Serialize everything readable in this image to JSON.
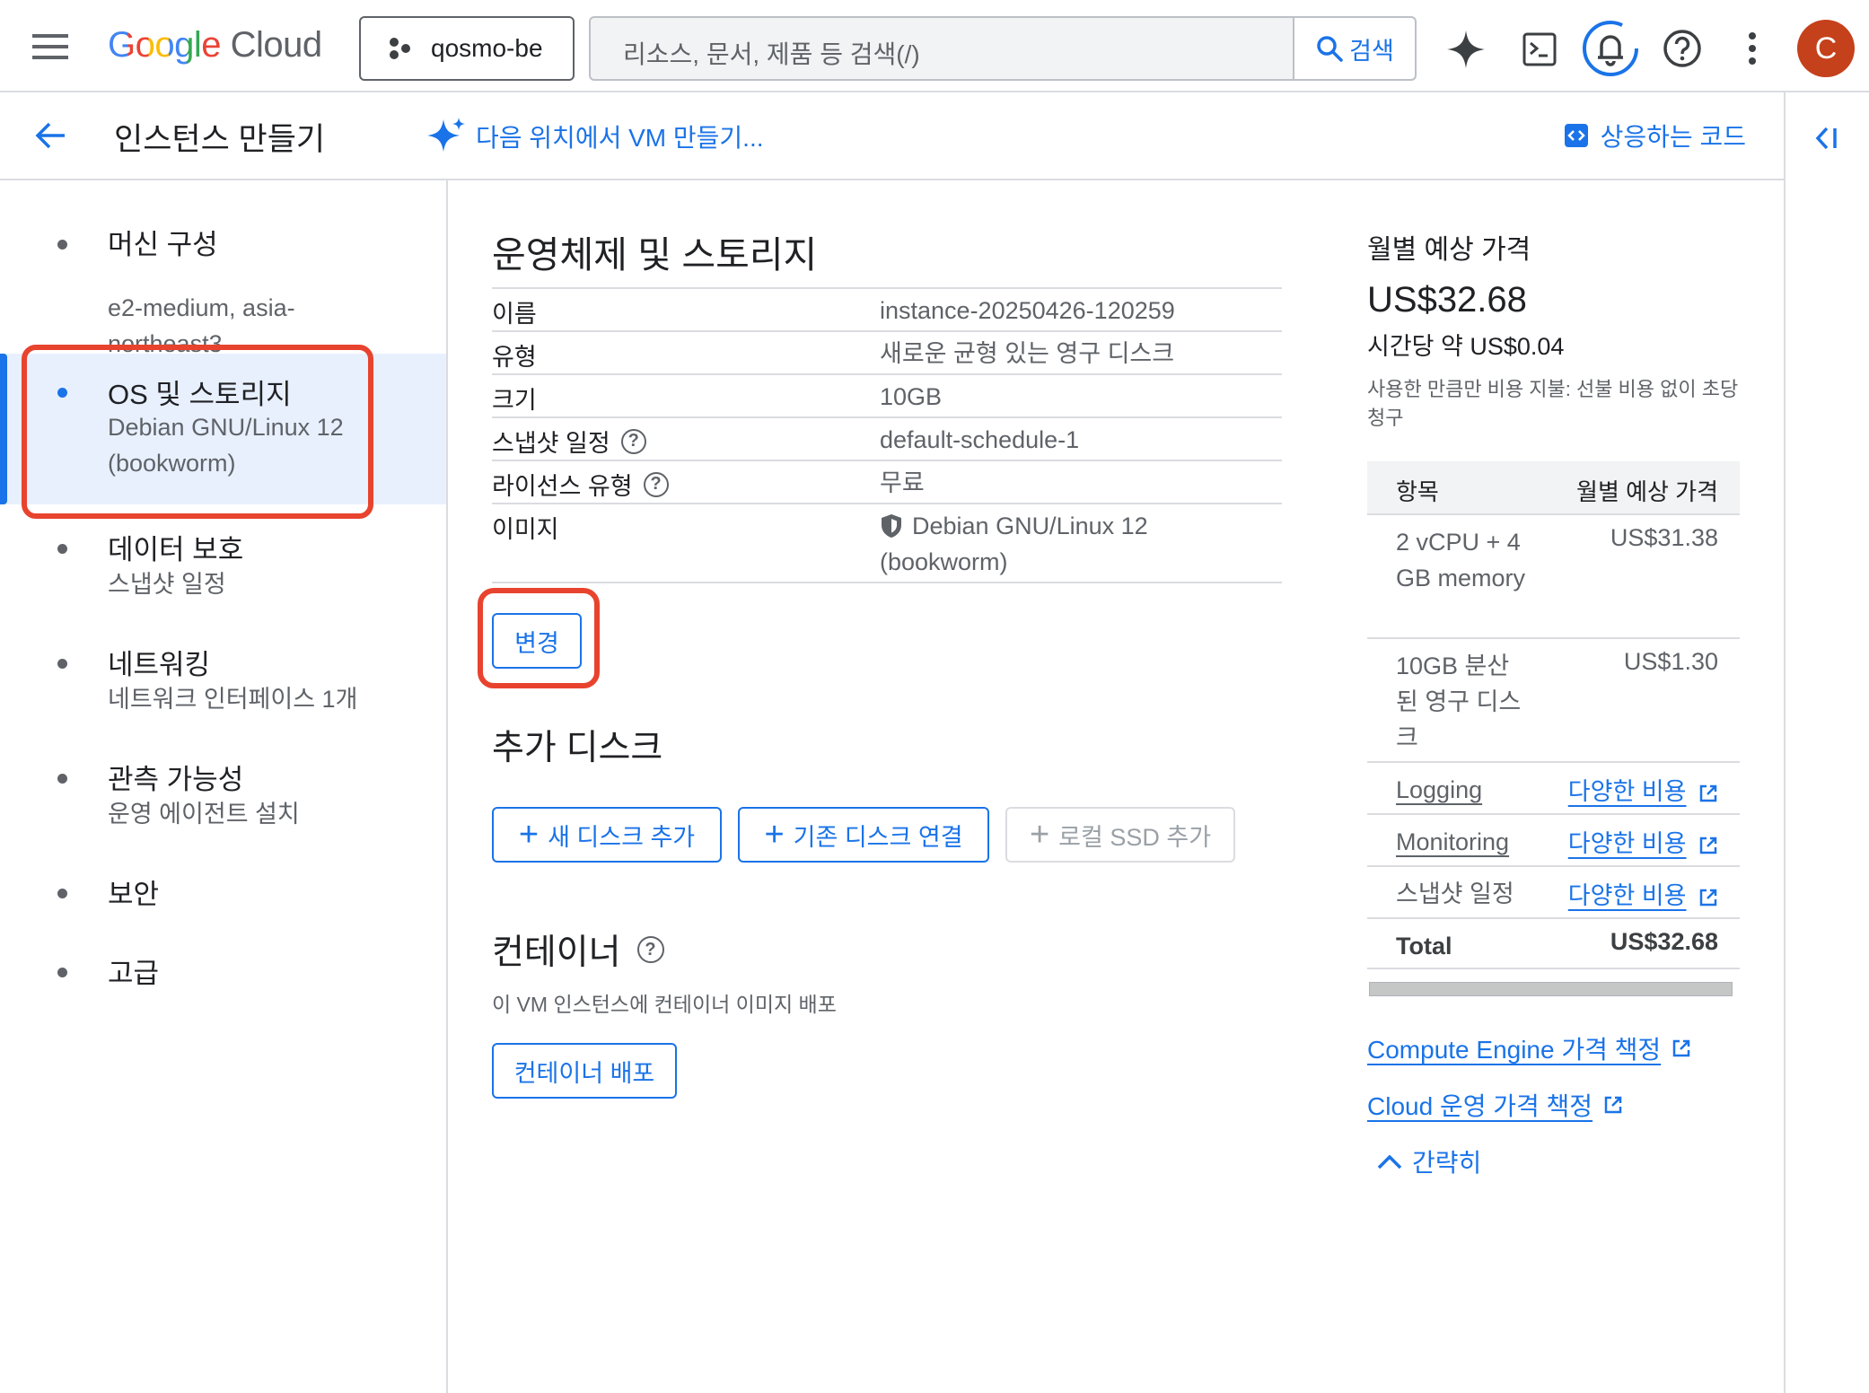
{
  "topbar": {
    "logo_google": "Google",
    "logo_cloud": "Cloud",
    "project": "qosmo-be",
    "search_placeholder": "리소스, 문서, 제품 등 검색(/)",
    "search_button": "검색",
    "avatar_letter": "C"
  },
  "header": {
    "title": "인스턴스 만들기",
    "vm_link": "다음 위치에서 VM 만들기...",
    "code_link": "상응하는 코드"
  },
  "sidebar": {
    "items": [
      {
        "title": "머신 구성",
        "sub": "e2-medium, asia-northeast3"
      },
      {
        "title": "OS 및 스토리지",
        "sub": "Debian GNU/Linux 12 (bookworm)"
      },
      {
        "title": "데이터 보호",
        "sub": "스냅샷 일정"
      },
      {
        "title": "네트워킹",
        "sub": "네트워크 인터페이스 1개"
      },
      {
        "title": "관측 가능성",
        "sub": "운영 에이전트 설치"
      },
      {
        "title": "보안",
        "sub": ""
      },
      {
        "title": "고급",
        "sub": ""
      }
    ]
  },
  "os_storage": {
    "heading": "운영체제 및 스토리지",
    "rows": [
      {
        "key": "이름",
        "value": "instance-20250426-120259"
      },
      {
        "key": "유형",
        "value": "새로운 균형 있는 영구 디스크"
      },
      {
        "key": "크기",
        "value": "10GB"
      },
      {
        "key": "스냅샷 일정",
        "value": "default-schedule-1"
      },
      {
        "key": "라이선스 유형",
        "value": "무료"
      },
      {
        "key": "이미지",
        "value_line1": "Debian GNU/Linux 12",
        "value_line2": "(bookworm)"
      }
    ],
    "change_button": "변경"
  },
  "extra_disk": {
    "heading": "추가 디스크",
    "add_new": "새 디스크 추가",
    "attach_existing": "기존 디스크 연결",
    "add_local_ssd": "로컬 SSD 추가"
  },
  "container": {
    "heading": "컨테이너",
    "desc": "이 VM 인스턴스에 컨테이너 이미지 배포",
    "deploy_button": "컨테이너 배포"
  },
  "pricing": {
    "title": "월별 예상 가격",
    "total": "US$32.68",
    "hourly": "시간당 약 US$0.04",
    "note": "사용한 만큼만 비용 지불: 선불 비용 없이 초당 청구",
    "col_item": "항목",
    "col_price": "월별 예상 가격",
    "rows": [
      {
        "item": "2 vCPU + 4 GB memory",
        "price": "US$31.38"
      },
      {
        "item": "10GB 분산된 영구 디스크",
        "price": "US$1.30"
      },
      {
        "item": "Logging",
        "price": "다양한 비용"
      },
      {
        "item": "Monitoring",
        "price": "다양한 비용"
      },
      {
        "item": "스냅샷 일정",
        "price": "다양한 비용"
      }
    ],
    "total_label": "Total",
    "total_value": "US$32.68",
    "link_compute": "Compute Engine 가격 책정",
    "link_ops": "Cloud 운영 가격 책정",
    "collapse": "간략히"
  },
  "colors": {
    "accent": "#1a73e8",
    "highlight_border": "#e8432e",
    "active_bg": "#e8f0fe",
    "avatar": "#c5411b"
  }
}
